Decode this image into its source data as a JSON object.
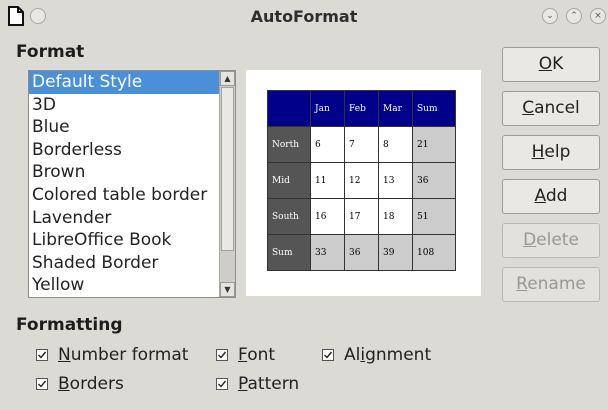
{
  "window": {
    "title": "AutoFormat"
  },
  "format": {
    "label": "Format",
    "styles": [
      "Default Style",
      "3D",
      "Blue",
      "Borderless",
      "Brown",
      "Colored table border",
      "Lavender",
      "LibreOffice Book",
      "Shaded Border",
      "Yellow"
    ],
    "selected": "Default Style"
  },
  "preview": {
    "header": [
      "",
      "Jan",
      "Feb",
      "Mar",
      "Sum"
    ],
    "rows": [
      [
        "North",
        "6",
        "7",
        "8",
        "21"
      ],
      [
        "Mid",
        "11",
        "12",
        "13",
        "36"
      ],
      [
        "South",
        "16",
        "17",
        "18",
        "51"
      ],
      [
        "Sum",
        "33",
        "36",
        "39",
        "108"
      ]
    ],
    "colors": {
      "header_bg": "#00008b",
      "row_header_bg": "#555555",
      "sum_bg": "#cccccc"
    }
  },
  "buttons": {
    "ok": {
      "pre": "",
      "mn": "O",
      "post": "K"
    },
    "cancel": {
      "pre": "",
      "mn": "C",
      "post": "ancel"
    },
    "help": {
      "pre": "",
      "mn": "H",
      "post": "elp"
    },
    "add": {
      "pre": "",
      "mn": "A",
      "post": "dd"
    },
    "delete": {
      "pre": "",
      "mn": "D",
      "post": "elete"
    },
    "rename": {
      "pre": "",
      "mn": "R",
      "post": "ename"
    }
  },
  "formatting": {
    "label": "Formatting",
    "number_format": {
      "pre": "",
      "mn": "N",
      "post": "umber format",
      "checked": true
    },
    "font": {
      "pre": "",
      "mn": "F",
      "post": "ont",
      "checked": true
    },
    "alignment": {
      "pre": "Al",
      "mn": "i",
      "post": "gnment",
      "checked": true
    },
    "borders": {
      "pre": "",
      "mn": "B",
      "post": "orders",
      "checked": true
    },
    "pattern": {
      "pre": "",
      "mn": "P",
      "post": "attern",
      "checked": true
    }
  },
  "icons": {
    "app": "document-icon",
    "menu": "window-menu-icon",
    "minimize": "minimize-icon",
    "maximize": "maximize-icon",
    "close": "close-icon"
  }
}
